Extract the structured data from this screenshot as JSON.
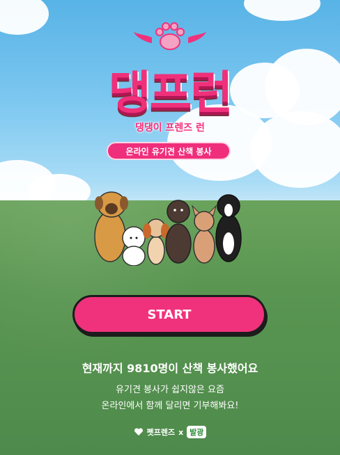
{
  "title": "댕프런",
  "subtitle": "댕댕이 프렌즈 런",
  "tagline": "온라인 유기견 산책 봉사",
  "start_label": "START",
  "count_text": "현재까지 9810명이 산책 봉사했어요",
  "description_line1": "유기견 봉사가 쉽지않은 요즘",
  "description_line2": "온라인에서 함께 달리면 기부해봐요!",
  "partner_left": "펫프렌즈",
  "partner_x": "x",
  "partner_right": "발광",
  "colors": {
    "primary": "#f0327c",
    "grass": "#5a9652",
    "sky": "#7cc7f0"
  },
  "icons": {
    "paw": "paw-icon",
    "wing": "wing-icon",
    "heart": "heart-icon"
  }
}
